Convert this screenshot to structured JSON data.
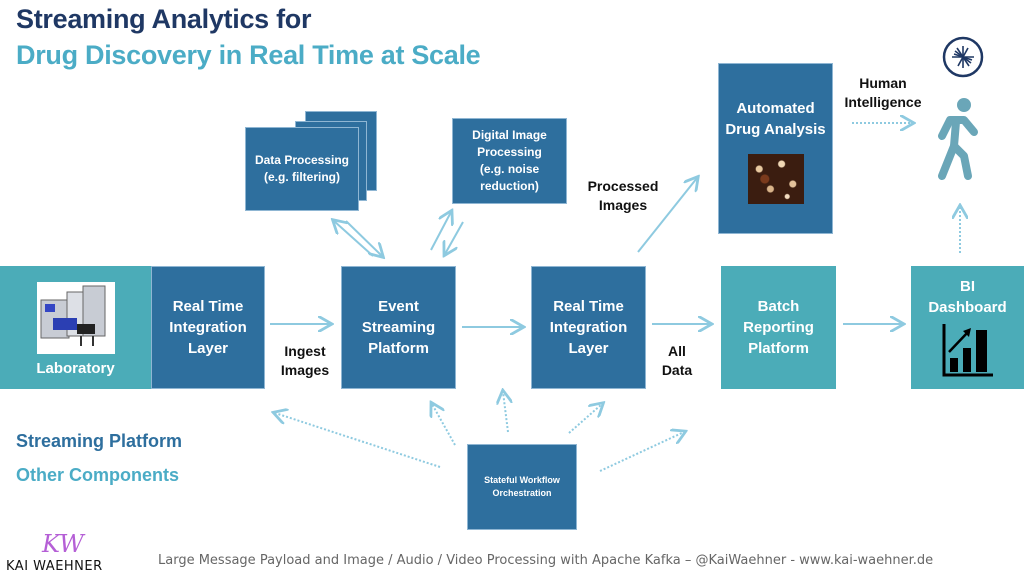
{
  "title": {
    "line1": "Streaming Analytics for",
    "line2": "Drug Discovery in Real Time at Scale"
  },
  "boxes": {
    "laboratory": "Laboratory",
    "rt_integration_left": [
      "Real Time",
      "Integration",
      "Layer"
    ],
    "event_streaming": [
      "Event",
      "Streaming",
      "Platform"
    ],
    "rt_integration_right": [
      "Real Time",
      "Integration",
      "Layer"
    ],
    "batch_reporting": [
      "Batch",
      "Reporting",
      "Platform"
    ],
    "bi_dashboard": [
      "BI",
      "Dashboard"
    ],
    "data_processing": [
      "Data Processing",
      "(e.g. filtering)"
    ],
    "digital_image": [
      "Digital Image",
      "Processing",
      "(e.g. noise",
      "reduction)"
    ],
    "automated_drug": [
      "Automated",
      "Drug Analysis"
    ],
    "workflow": [
      "Stateful Workflow",
      "Orchestration"
    ]
  },
  "labels": {
    "ingest": [
      "Ingest",
      "Images"
    ],
    "all_data": [
      "All",
      "Data"
    ],
    "processed": [
      "Processed",
      "Images"
    ],
    "human": [
      "Human",
      "Intelligence"
    ]
  },
  "legend": {
    "streaming_platform": "Streaming Platform",
    "other_components": "Other Components"
  },
  "colors": {
    "streaming_platform": "#2e6f9e",
    "other_components": "#4bacb8",
    "arrow": "#8ecae0",
    "title_dark": "#1f3864",
    "title_light": "#4bacc6"
  },
  "footer": {
    "brand_monogram": "KW",
    "brand_name": "KAI WAEHNER",
    "text": "Large Message Payload and Image / Audio / Video Processing with Apache Kafka – @KaiWaehner - www.kai-waehner.de"
  }
}
